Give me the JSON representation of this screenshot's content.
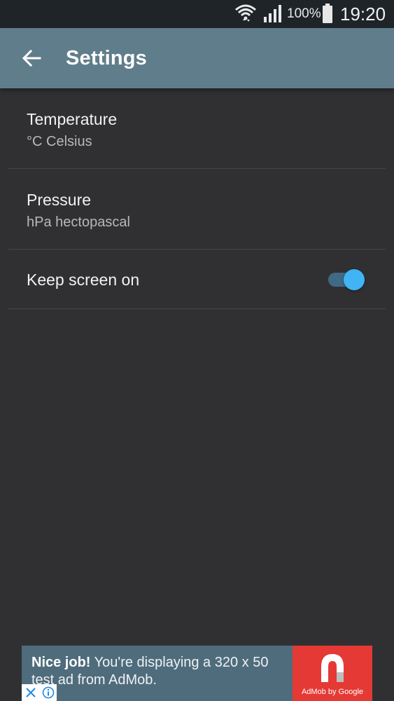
{
  "status_bar": {
    "battery_percent": "100%",
    "time": "19:20",
    "icons": [
      "wifi-icon",
      "signal-icon",
      "battery-icon"
    ]
  },
  "app_bar": {
    "title": "Settings",
    "back_icon": "arrow-back-icon"
  },
  "settings": {
    "temperature": {
      "label": "Temperature",
      "summary": "°C Celsius"
    },
    "pressure": {
      "label": "Pressure",
      "summary": "hPa hectopascal"
    },
    "keep_screen_on": {
      "label": "Keep screen on",
      "enabled": true
    }
  },
  "ad": {
    "headline": "Nice job!",
    "body": " You're displaying a 320 x 50 test ad from AdMob.",
    "byline": "AdMob by Google"
  },
  "colors": {
    "app_bar": "#607d8b",
    "status_bar": "#1f2429",
    "background": "#303032",
    "accent": "#40b4f5",
    "ad_logo_bg": "#e53935"
  }
}
